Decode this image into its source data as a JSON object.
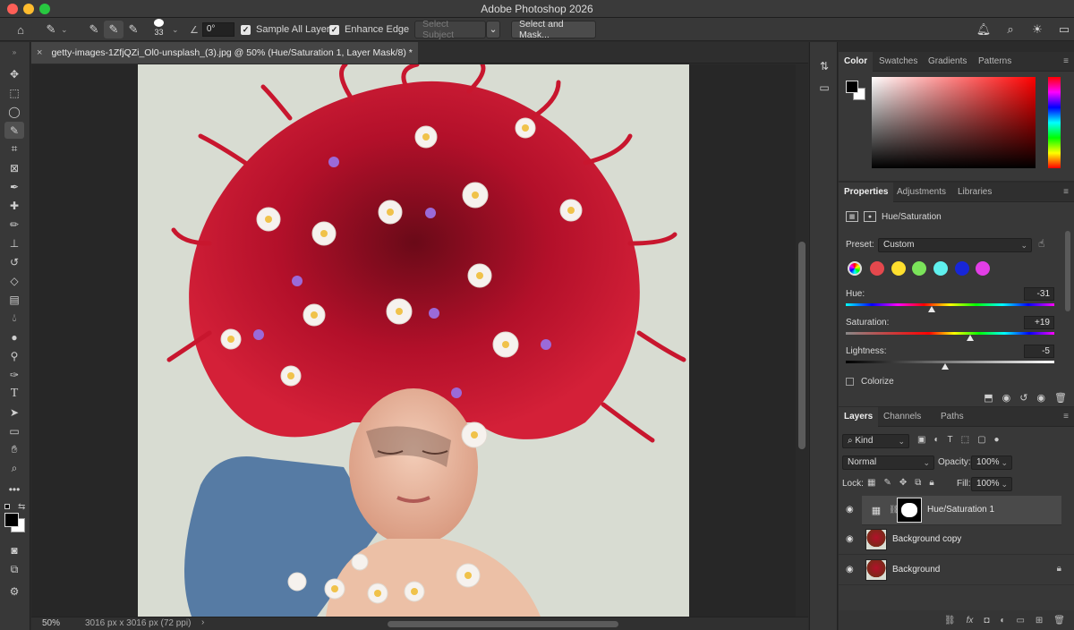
{
  "window": {
    "title": "Adobe Photoshop 2026"
  },
  "options_bar": {
    "brush_size": "33",
    "angle": "0°",
    "sample_all_layers": "Sample All Layers",
    "enhance_edge": "Enhance Edge",
    "select_subject": "Select Subject",
    "select_and_mask": "Select and Mask..."
  },
  "document": {
    "tab_title": "getty-images-1ZfjQZi_Ol0-unsplash_(3).jpg @ 50% (Hue/Saturation 1, Layer Mask/8) *",
    "zoom": "50%",
    "dimensions": "3016 px x 3016 px (72 ppi)"
  },
  "color_panel": {
    "tabs": [
      "Color",
      "Swatches",
      "Gradients",
      "Patterns"
    ],
    "foreground": "#000000",
    "background": "#ffffff"
  },
  "properties_panel": {
    "tabs": [
      "Properties",
      "Adjustments",
      "Libraries"
    ],
    "adjustment_name": "Hue/Saturation",
    "preset_label": "Preset:",
    "preset_value": "Custom",
    "range_colors": [
      "#e5484d",
      "#ffdf2e",
      "#7be35a",
      "#5ff0ee",
      "#1726d8",
      "#e23ee6"
    ],
    "hue_label": "Hue:",
    "hue_value": "-31",
    "saturation_label": "Saturation:",
    "saturation_value": "+19",
    "lightness_label": "Lightness:",
    "lightness_value": "-5",
    "colorize_label": "Colorize"
  },
  "layers_panel": {
    "tabs": [
      "Layers",
      "Channels",
      "Paths"
    ],
    "kind_label": "Kind",
    "blend_mode": "Normal",
    "opacity_label": "Opacity:",
    "opacity_value": "100%",
    "lock_label": "Lock:",
    "fill_label": "Fill:",
    "fill_value": "100%",
    "layers": [
      {
        "name": "Hue/Saturation 1"
      },
      {
        "name": "Background copy"
      },
      {
        "name": "Background"
      }
    ]
  }
}
